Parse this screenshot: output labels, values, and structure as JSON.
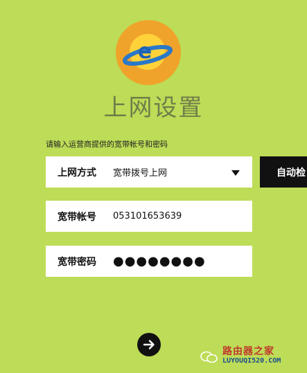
{
  "logo": {
    "letter": "e"
  },
  "page_title": "上网设置",
  "hint": "请输入运营商提供的宽带帐号和密码",
  "connection_type": {
    "label": "上网方式",
    "value": "宽带拨号上网"
  },
  "auto_detect_label": "自动检",
  "account": {
    "label": "宽带帐号",
    "value": "053101653639"
  },
  "password": {
    "label": "宽带密码",
    "value": "●●●●●●●●"
  },
  "watermark": {
    "cn": "路由器之家",
    "en": "LUYOUQI520.COM"
  },
  "colors": {
    "background": "#bddc57",
    "logo_orange": "#f4a223",
    "logo_ring": "#2a78c8",
    "dark": "#111111"
  }
}
